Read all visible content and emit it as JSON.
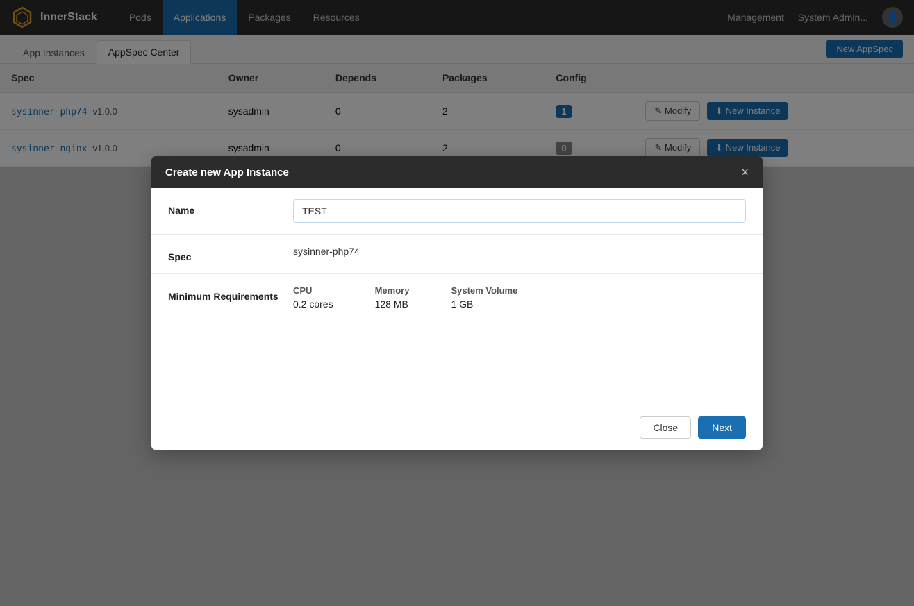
{
  "app": {
    "title": "InnerStack"
  },
  "navbar": {
    "items": [
      {
        "id": "pods",
        "label": "Pods",
        "active": false
      },
      {
        "id": "applications",
        "label": "Applications",
        "active": true
      },
      {
        "id": "packages",
        "label": "Packages",
        "active": false
      },
      {
        "id": "resources",
        "label": "Resources",
        "active": false
      }
    ],
    "right": {
      "management_label": "Management",
      "sysadmin_label": "System Admin..."
    }
  },
  "subnav": {
    "tabs": [
      {
        "id": "app-instances",
        "label": "App Instances",
        "active": false
      },
      {
        "id": "appspec-center",
        "label": "AppSpec Center",
        "active": true
      }
    ],
    "new_appspec_button": "New AppSpec"
  },
  "table": {
    "headers": [
      "Spec",
      "Owner",
      "Depends",
      "Packages",
      "Config"
    ],
    "rows": [
      {
        "spec_name": "sysinner-php74",
        "spec_version": "v1.0.0",
        "owner": "sysadmin",
        "depends": "0",
        "packages": "2",
        "config": "1",
        "config_zero": false,
        "modify_label": "Modify",
        "new_instance_label": "New Instance"
      },
      {
        "spec_name": "sysinner-nginx",
        "spec_version": "v1.0.0",
        "owner": "sysadmin",
        "depends": "0",
        "packages": "2",
        "config": "0",
        "config_zero": true,
        "modify_label": "Modify",
        "new_instance_label": "New Instance"
      }
    ]
  },
  "modal": {
    "title": "Create new App Instance",
    "close_icon": "×",
    "name_label": "Name",
    "name_value": "TEST",
    "name_placeholder": "",
    "spec_label": "Spec",
    "spec_value": "sysinner-php74",
    "min_req_label": "Minimum Requirements",
    "cpu_label": "CPU",
    "cpu_value": "0.2 cores",
    "memory_label": "Memory",
    "memory_value": "128 MB",
    "system_volume_label": "System Volume",
    "system_volume_value": "1 GB",
    "close_button": "Close",
    "next_button": "Next"
  },
  "icons": {
    "logo": "⬡",
    "edit": "✎",
    "download": "⬇",
    "user": "👤"
  }
}
